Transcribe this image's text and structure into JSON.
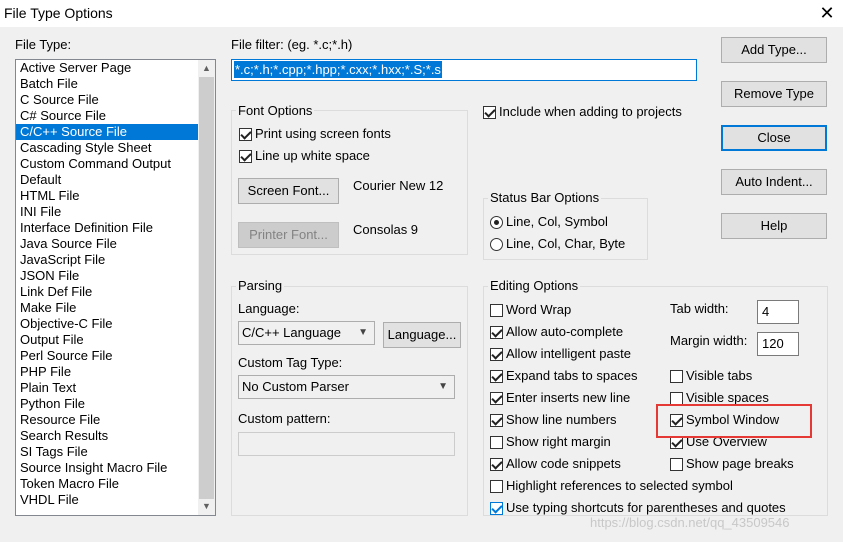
{
  "window": {
    "title": "File Type Options"
  },
  "file_type": {
    "label": "File Type:",
    "items": [
      "Active Server Page",
      "Batch File",
      "C Source File",
      "C# Source File",
      "C/C++ Source File",
      "Cascading Style Sheet",
      "Custom Command Output",
      "Default",
      "HTML File",
      "INI File",
      "Interface Definition File",
      "Java Source File",
      "JavaScript File",
      "JSON File",
      "Link Def File",
      "Make File",
      "Objective-C File",
      "Output File",
      "Perl Source File",
      "PHP File",
      "Plain Text",
      "Python File",
      "Resource File",
      "Search Results",
      "SI Tags File",
      "Source Insight Macro File",
      "Token Macro File",
      "VHDL File"
    ],
    "selected": "C/C++ Source File"
  },
  "filter": {
    "label": "File filter: (eg. *.c;*.h)",
    "value": "*.c;*.h;*.cpp;*.hpp;*.cxx;*.hxx;*.S;*.s"
  },
  "include_in_projects": {
    "label": "Include when adding to projects",
    "checked": true
  },
  "font_options": {
    "title": "Font Options",
    "screen_fonts_label": "Print using screen fonts",
    "line_up_label": "Line up white space",
    "screen_font_button": "Screen Font...",
    "screen_font_value": "Courier New 12",
    "printer_font_button": "Printer Font...",
    "printer_font_value": "Consolas 9"
  },
  "status_bar": {
    "title": "Status Bar Options",
    "opt1": "Line, Col, Symbol",
    "opt2": "Line, Col, Char, Byte"
  },
  "parsing": {
    "title": "Parsing",
    "language_label": "Language:",
    "language_value": "C/C++ Language",
    "language_button": "Language...",
    "custom_tag_label": "Custom Tag Type:",
    "custom_tag_value": "No Custom Parser",
    "custom_pattern_label": "Custom pattern:",
    "custom_pattern_value": ""
  },
  "editing": {
    "title": "Editing Options",
    "word_wrap": "Word Wrap",
    "auto_complete": "Allow auto-complete",
    "intelligent_paste": "Allow intelligent paste",
    "expand_tabs": "Expand tabs to spaces",
    "enter_inserts": "Enter inserts new line",
    "show_line_numbers": "Show line numbers",
    "show_right_margin": "Show right margin",
    "code_snippets": "Allow code snippets",
    "highlight_refs": "Highlight references to selected symbol",
    "typing_shortcuts": "Use typing shortcuts for parentheses and quotes",
    "tab_width_label": "Tab width:",
    "tab_width_value": "4",
    "margin_width_label": "Margin width:",
    "margin_width_value": "120",
    "visible_tabs": "Visible tabs",
    "visible_spaces": "Visible spaces",
    "symbol_window": "Symbol Window",
    "use_overview": "Use Overview",
    "show_page_breaks": "Show page breaks"
  },
  "buttons": {
    "add_type": "Add Type...",
    "remove_type": "Remove Type",
    "close": "Close",
    "auto_indent": "Auto Indent...",
    "help": "Help"
  },
  "watermark": "https://blog.csdn.net/qq_43509546",
  "colors": {
    "accent": "#0078d7",
    "highlight_box": "#e53935",
    "dialog_bg": "#f0f0f0"
  }
}
